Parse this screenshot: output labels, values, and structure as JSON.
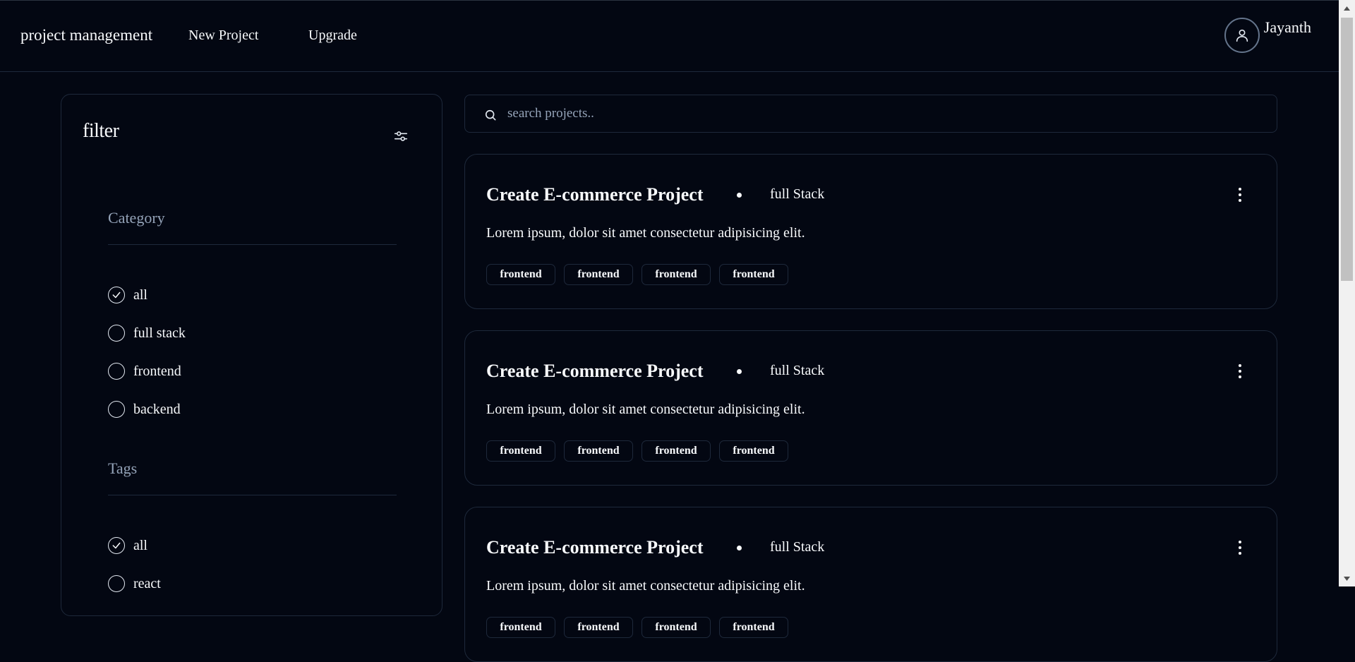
{
  "header": {
    "brand": "project management",
    "nav": [
      {
        "label": "New Project"
      },
      {
        "label": "Upgrade"
      }
    ],
    "user": {
      "name": "Jayanth",
      "icon": "user-icon"
    }
  },
  "filter": {
    "title": "filter",
    "icon": "sliders-icon",
    "category": {
      "title": "Category",
      "options": [
        {
          "label": "all",
          "selected": true
        },
        {
          "label": "full stack",
          "selected": false
        },
        {
          "label": "frontend",
          "selected": false
        },
        {
          "label": "backend",
          "selected": false
        }
      ]
    },
    "tags": {
      "title": "Tags",
      "options": [
        {
          "label": "all",
          "selected": true
        },
        {
          "label": "react",
          "selected": false
        }
      ]
    }
  },
  "search": {
    "placeholder": "search projects..",
    "value": "",
    "icon": "search-icon"
  },
  "projects": [
    {
      "title": "Create E-commerce Project",
      "category": "full Stack",
      "description": "Lorem ipsum, dolor sit amet consectetur adipisicing elit.",
      "tags": [
        "frontend",
        "frontend",
        "frontend",
        "frontend"
      ]
    },
    {
      "title": "Create E-commerce Project",
      "category": "full Stack",
      "description": "Lorem ipsum, dolor sit amet consectetur adipisicing elit.",
      "tags": [
        "frontend",
        "frontend",
        "frontend",
        "frontend"
      ]
    },
    {
      "title": "Create E-commerce Project",
      "category": "full Stack",
      "description": "Lorem ipsum, dolor sit amet consectetur adipisicing elit.",
      "tags": [
        "frontend",
        "frontend",
        "frontend",
        "frontend"
      ]
    }
  ],
  "colors": {
    "background": "#030712",
    "border": "#1e293b",
    "muted": "#94a3b8",
    "text": "#f8fafc"
  }
}
